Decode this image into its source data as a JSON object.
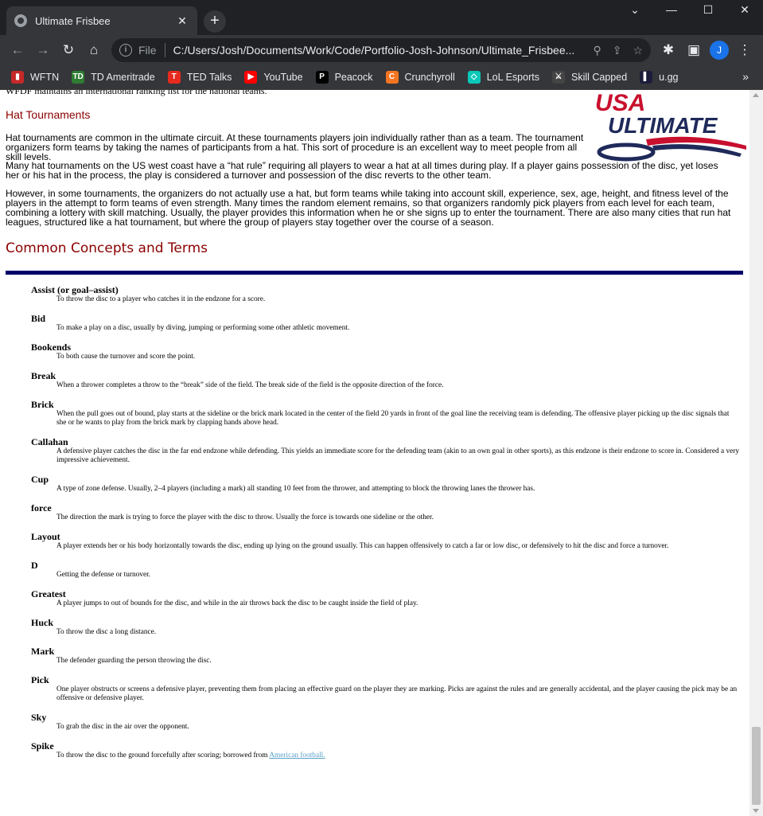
{
  "browser": {
    "tab_title": "Ultimate Frisbee",
    "tab_close": "✕",
    "new_tab": "+",
    "window_controls": {
      "chevron": "⌄",
      "minimize": "—",
      "maximize": "☐",
      "close": "✕"
    },
    "scheme": "File",
    "url": "C:/Users/Josh/Documents/Work/Code/Portfolio-Josh-Johnson/Ultimate_Frisbee...",
    "profile_initial": "J",
    "bookmarks": [
      {
        "label": "WFTN",
        "icon": "wftn-icon",
        "color": "#c62828",
        "glyph": "▮"
      },
      {
        "label": "TD Ameritrade",
        "icon": "td-ameritrade-icon",
        "color": "#2e7d32",
        "glyph": "TD"
      },
      {
        "label": "TED Talks",
        "icon": "ted-icon",
        "color": "#e62b1e",
        "glyph": "T"
      },
      {
        "label": "YouTube",
        "icon": "youtube-icon",
        "color": "#ff0000",
        "glyph": "▶"
      },
      {
        "label": "Peacock",
        "icon": "peacock-icon",
        "color": "#000000",
        "glyph": "P"
      },
      {
        "label": "Crunchyroll",
        "icon": "crunchyroll-icon",
        "color": "#f47521",
        "glyph": "C"
      },
      {
        "label": "LoL Esports",
        "icon": "lol-esports-icon",
        "color": "#0ac8b9",
        "glyph": "◇"
      },
      {
        "label": "Skill Capped",
        "icon": "skill-capped-icon",
        "color": "#444444",
        "glyph": "⚔"
      },
      {
        "label": "u.gg",
        "icon": "ugg-icon",
        "color": "#1c1c3a",
        "glyph": "▌"
      }
    ],
    "bookmarks_more": "»"
  },
  "page": {
    "cut_off_line": "WFDF maintains an international ranking list for the national teams.",
    "logo": {
      "line1": "USA",
      "line2": "ULTIMATE"
    },
    "hat_heading": "Hat Tournaments",
    "hat_paragraphs": [
      "Hat tournaments are common in the ultimate circuit. At these tournaments players join individually rather than as a team. The tournament organizers form teams by taking the names of participants from a hat. This sort of procedure is an excellent way to meet people from all skill levels.",
      "Many hat tournaments on the US west coast have a “hat rule” requiring all players to wear a hat at all times during play. If a player gains possession of the disc, yet loses her or his hat in the process, the play is considered a turnover and possession of the disc reverts to the other team.",
      "However, in some tournaments, the organizers do not actually use a hat, but form teams while taking into account skill, experience, sex, age, height, and fitness level of the players in the attempt to form teams of even strength. Many times the random element remains, so that organizers randomly pick players from each level for each team, combining a lottery with skill matching. Usually, the player provides this information when he or she signs up to enter the tournament. There are also many cities that run hat leagues, structured like a hat tournament, but where the group of players stay together over the course of a season."
    ],
    "concepts_heading": "Common Concepts and Terms",
    "terms": [
      {
        "term": "Assist (or goal–assist)",
        "def": "To throw the disc to a player who catches it in the endzone for a score."
      },
      {
        "term": "Bid",
        "def": "To make a play on a disc, usually by diving, jumping or performing some other athletic movement."
      },
      {
        "term": "Bookends",
        "def": "To both cause the turnover and score the point."
      },
      {
        "term": "Break",
        "def": "When a thrower completes a throw to the “break” side of the field. The break side of the field is the opposite direction of the force."
      },
      {
        "term": "Brick",
        "def": "When the pull goes out of bound, play starts at the sideline or the brick mark located in the center of the field 20 yards in front of the goal line the receiving team is defending. The offensive player picking up the disc signals that she or he wants to play from the brick mark by clapping hands above head."
      },
      {
        "term": "Callahan",
        "def": "A defensive player catches the disc in the far end endzone while defending. This yields an immediate score for the defending team (akin to an own goal in other sports), as this endzone is their endzone to score in. Considered a very impressive achievement."
      },
      {
        "term": "Cup",
        "def": "A type of zone defense. Usually, 2–4 players (including a mark) all standing 10 feet from the thrower, and attempting to block the throwing lanes the thrower has."
      },
      {
        "term": "force",
        "def": "The direction the mark is trying to force the player with the disc to throw. Usually the force is towards one sideline or the other."
      },
      {
        "term": "Layout",
        "def": "A player extends her or his body horizontally towards the disc, ending up lying on the ground usually. This can happen offensively to catch a far or low disc, or defensively to hit the disc and force a turnover."
      },
      {
        "term": "D",
        "def": "Getting the defense or turnover."
      },
      {
        "term": "Greatest",
        "def": "A player jumps to out of bounds for the disc, and while in the air throws back the disc to be caught inside the field of play."
      },
      {
        "term": "Huck",
        "def": "To throw the disc a long distance."
      },
      {
        "term": "Mark",
        "def": "The defender guarding the person throwing the disc."
      },
      {
        "term": "Pick",
        "def": "One player obstructs or screens a defensive player, preventing them from placing an effective guard on the player they are marking. Picks are against the rules and are generally accidental, and the player causing the pick may be an offensive or defensive player."
      },
      {
        "term": "Sky",
        "def": "To grab the disc in the air over the opponent."
      },
      {
        "term": "Spike",
        "def": "To throw the disc to the ground forcefully after scoring; borrowed from ",
        "link": "American football."
      }
    ]
  }
}
